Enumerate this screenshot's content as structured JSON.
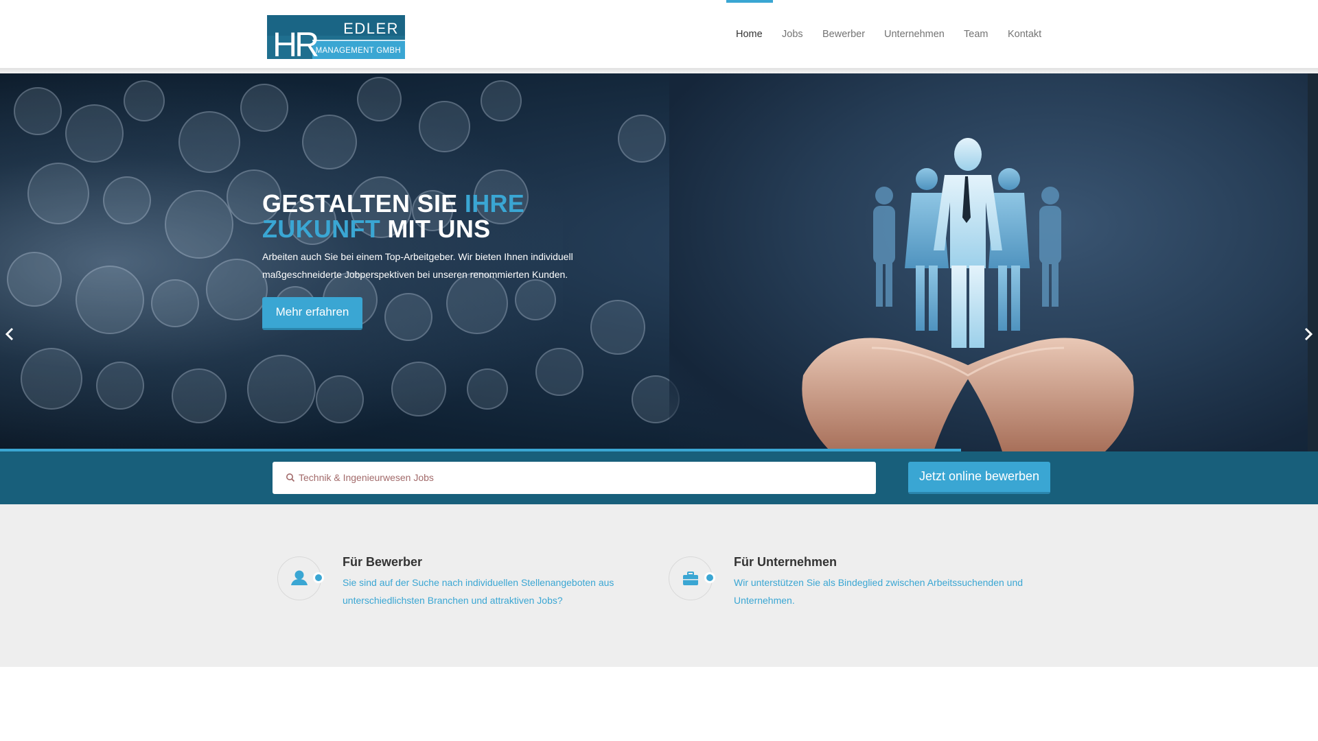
{
  "brand": {
    "logo_initials": "HR",
    "logo_name": "EDLER",
    "logo_sub": "MANAGEMENT GMBH",
    "colors": {
      "accent": "#3aa6d3",
      "dark_teal": "#185f7b",
      "logo_dark": "#1f6f8f"
    }
  },
  "nav": {
    "items": [
      {
        "label": "Home",
        "active": true
      },
      {
        "label": "Jobs"
      },
      {
        "label": "Bewerber"
      },
      {
        "label": "Unternehmen"
      },
      {
        "label": "Team"
      },
      {
        "label": "Kontakt"
      }
    ]
  },
  "hero": {
    "title_part1": "GESTALTEN SIE ",
    "title_accent1": "IHRE",
    "title_accent2": "ZUKUNFT",
    "title_part2": " MIT UNS",
    "text": "Arbeiten auch Sie bei einem Top-Arbeitgeber. Wir bieten Ihnen individuell maßgeschneiderte Jobperspektiven bei unseren renommierten Kunden.",
    "button": "Mehr erfahren",
    "prev_icon": "chevron-left-icon",
    "next_icon": "chevron-right-icon"
  },
  "search": {
    "placeholder": "Technik & Ingenieurwesen Jobs",
    "icon": "search-icon",
    "apply_button": "Jetzt online bewerben"
  },
  "features": [
    {
      "icon": "user-icon",
      "title": "Für Bewerber",
      "text": "Sie sind auf der Suche nach individuellen Stellenangeboten aus unterschiedlichsten Branchen und attraktiven Jobs?"
    },
    {
      "icon": "briefcase-icon",
      "title": "Für Unternehmen",
      "text": "Wir unterstützen Sie als Bindeglied zwischen Arbeitssuchenden und Unternehmen."
    }
  ]
}
